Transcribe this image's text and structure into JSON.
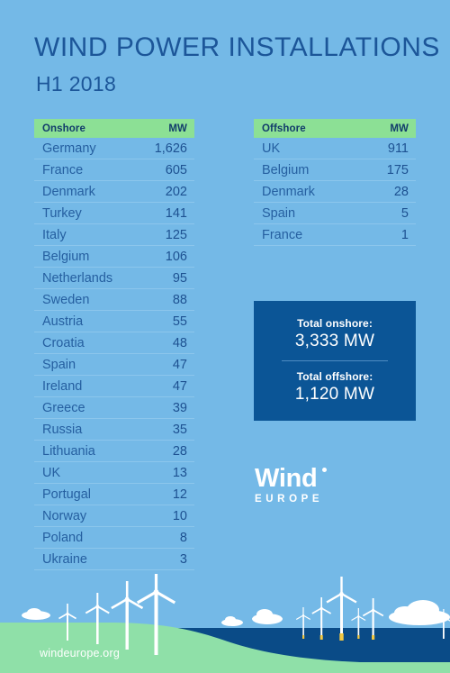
{
  "header": {
    "title": "WIND POWER INSTALLATIONS",
    "subtitle": "H1 2018"
  },
  "colors": {
    "background": "#74b9e7",
    "header_green": "#8ce095",
    "navy_text": "#1c5699",
    "totals_box": "#0b5596",
    "land_green": "#8fe0a8",
    "sea_blue": "#0a4b87",
    "white": "#ffffff",
    "turbine_base_yellow": "#f4c842"
  },
  "onshore_table": {
    "header": {
      "name": "Onshore",
      "unit": "MW"
    },
    "rows": [
      {
        "country": "Germany",
        "mw": "1,626"
      },
      {
        "country": "France",
        "mw": "605"
      },
      {
        "country": "Denmark",
        "mw": "202"
      },
      {
        "country": "Turkey",
        "mw": "141"
      },
      {
        "country": "Italy",
        "mw": "125"
      },
      {
        "country": "Belgium",
        "mw": "106"
      },
      {
        "country": "Netherlands",
        "mw": "95"
      },
      {
        "country": "Sweden",
        "mw": "88"
      },
      {
        "country": "Austria",
        "mw": "55"
      },
      {
        "country": "Croatia",
        "mw": "48"
      },
      {
        "country": "Spain",
        "mw": "47"
      },
      {
        "country": "Ireland",
        "mw": "47"
      },
      {
        "country": "Greece",
        "mw": "39"
      },
      {
        "country": "Russia",
        "mw": "35"
      },
      {
        "country": "Lithuania",
        "mw": "28"
      },
      {
        "country": "UK",
        "mw": "13"
      },
      {
        "country": "Portugal",
        "mw": "12"
      },
      {
        "country": "Norway",
        "mw": "10"
      },
      {
        "country": "Poland",
        "mw": "8"
      },
      {
        "country": "Ukraine",
        "mw": "3"
      }
    ]
  },
  "offshore_table": {
    "header": {
      "name": "Offshore",
      "unit": "MW"
    },
    "rows": [
      {
        "country": "UK",
        "mw": "911"
      },
      {
        "country": "Belgium",
        "mw": "175"
      },
      {
        "country": "Denmark",
        "mw": "28"
      },
      {
        "country": "Spain",
        "mw": "5"
      },
      {
        "country": "France",
        "mw": "1"
      }
    ]
  },
  "totals": {
    "onshore_label": "Total onshore:",
    "onshore_value": "3,333 MW",
    "offshore_label": "Total offshore:",
    "offshore_value": "1,120 MW"
  },
  "logo": {
    "wind": "Wind",
    "europe": "EUROPE"
  },
  "footer": {
    "url": "windeurope.org"
  },
  "chart_data": {
    "type": "table",
    "title": "WIND POWER INSTALLATIONS",
    "subtitle": "H1 2018",
    "unit": "MW",
    "series": [
      {
        "name": "Onshore",
        "categories": [
          "Germany",
          "France",
          "Denmark",
          "Turkey",
          "Italy",
          "Belgium",
          "Netherlands",
          "Sweden",
          "Austria",
          "Croatia",
          "Spain",
          "Ireland",
          "Greece",
          "Russia",
          "Lithuania",
          "UK",
          "Portugal",
          "Norway",
          "Poland",
          "Ukraine"
        ],
        "values": [
          1626,
          605,
          202,
          141,
          125,
          106,
          95,
          88,
          55,
          48,
          47,
          47,
          39,
          35,
          28,
          13,
          12,
          10,
          8,
          3
        ],
        "total": 3333
      },
      {
        "name": "Offshore",
        "categories": [
          "UK",
          "Belgium",
          "Denmark",
          "Spain",
          "France"
        ],
        "values": [
          911,
          175,
          28,
          5,
          1
        ],
        "total": 1120
      }
    ]
  }
}
